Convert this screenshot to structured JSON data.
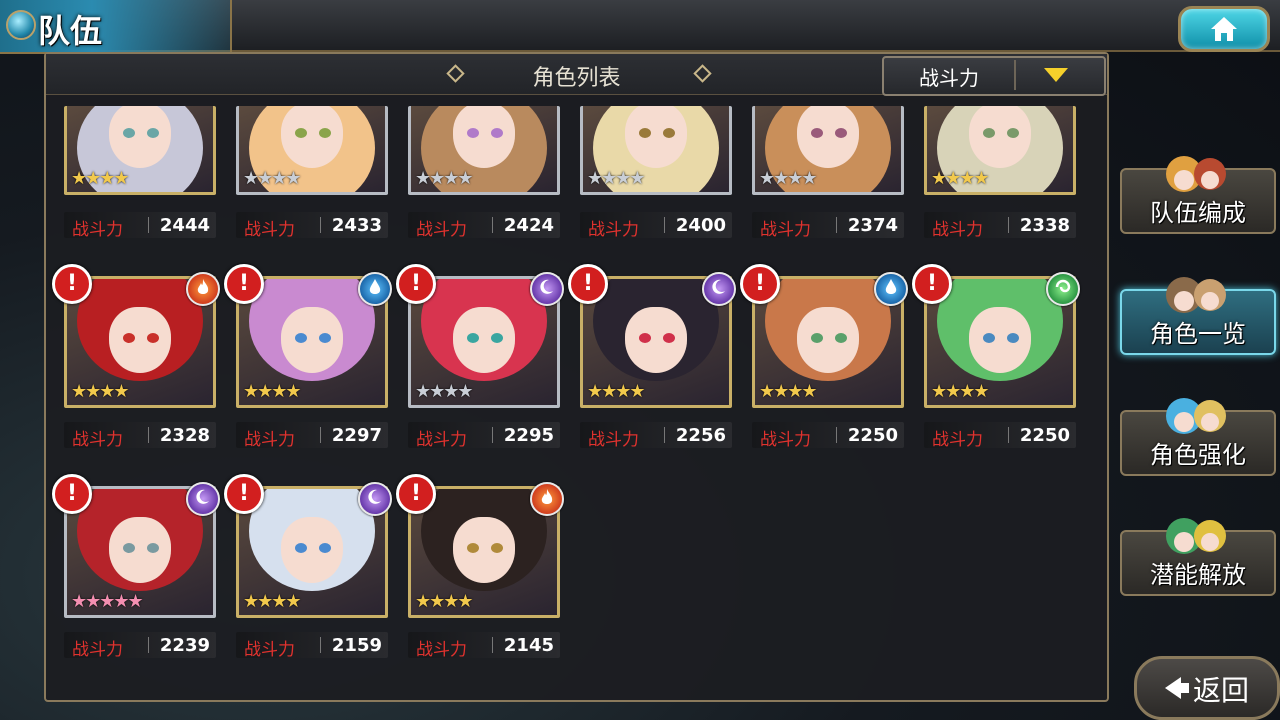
{
  "header": {
    "title": "队伍",
    "home_icon": "home-icon"
  },
  "panel": {
    "title": "角色列表",
    "sort_label": "战斗力"
  },
  "power_label": "战斗力",
  "characters": [
    {
      "power": "2444",
      "stars": 4,
      "star_color": "gold",
      "frame": "gold",
      "alert": false,
      "element": null,
      "hair": "#c7c7d8",
      "eyes": "#6aa6a6"
    },
    {
      "power": "2433",
      "stars": 4,
      "star_color": "silver",
      "frame": "silver",
      "alert": false,
      "element": null,
      "hair": "#f2c38a",
      "eyes": "#8aa44a"
    },
    {
      "power": "2424",
      "stars": 4,
      "star_color": "silver",
      "frame": "silver",
      "alert": false,
      "element": null,
      "hair": "#b98a5e",
      "eyes": "#b07ac9"
    },
    {
      "power": "2400",
      "stars": 4,
      "star_color": "silver",
      "frame": "silver",
      "alert": false,
      "element": null,
      "hair": "#e9d9a8",
      "eyes": "#9a7a3a"
    },
    {
      "power": "2374",
      "stars": 4,
      "star_color": "silver",
      "frame": "silver",
      "alert": false,
      "element": null,
      "hair": "#c98f5a",
      "eyes": "#9a5a7a"
    },
    {
      "power": "2338",
      "stars": 4,
      "star_color": "gold",
      "frame": "gold",
      "alert": false,
      "element": null,
      "hair": "#d8d3b8",
      "eyes": "#7a9a6a"
    },
    {
      "power": "2328",
      "stars": 4,
      "star_color": "gold",
      "frame": "gold",
      "alert": true,
      "element": "fire",
      "hair": "#b81f22",
      "eyes": "#c9302a"
    },
    {
      "power": "2297",
      "stars": 4,
      "star_color": "gold",
      "frame": "gold",
      "alert": true,
      "element": "water",
      "hair": "#c98ad0",
      "eyes": "#4a8ad0"
    },
    {
      "power": "2295",
      "stars": 4,
      "star_color": "silver",
      "frame": "silver",
      "alert": true,
      "element": "dark",
      "hair": "#d8344f",
      "eyes": "#3aa6a0"
    },
    {
      "power": "2256",
      "stars": 4,
      "star_color": "gold",
      "frame": "gold",
      "alert": true,
      "element": "dark",
      "hair": "#2a2430",
      "eyes": "#d0304a"
    },
    {
      "power": "2250",
      "stars": 4,
      "star_color": "gold",
      "frame": "gold",
      "alert": true,
      "element": "water",
      "hair": "#c9784a",
      "eyes": "#5aa06a"
    },
    {
      "power": "2250",
      "stars": 4,
      "star_color": "gold",
      "frame": "gold",
      "alert": true,
      "element": "wind",
      "hair": "#5fbf6a",
      "eyes": "#4a8ac0"
    },
    {
      "power": "2239",
      "stars": 5,
      "star_color": "pink",
      "frame": "silver",
      "alert": true,
      "element": "dark",
      "hair": "#b5232a",
      "eyes": "#7a9aa0"
    },
    {
      "power": "2159",
      "stars": 4,
      "star_color": "gold",
      "frame": "gold",
      "alert": true,
      "element": "dark",
      "hair": "#d6e0ee",
      "eyes": "#4a8ad0"
    },
    {
      "power": "2145",
      "stars": 4,
      "star_color": "gold",
      "frame": "gold",
      "alert": true,
      "element": "fire",
      "hair": "#2c2220",
      "eyes": "#b08a3a"
    }
  ],
  "side_menu": [
    {
      "label": "队伍编成",
      "icon": "team-formation-icon",
      "active": false
    },
    {
      "label": "角色一览",
      "icon": "character-book-icon",
      "active": true
    },
    {
      "label": "角色强化",
      "icon": "enhance-crystal-icon",
      "active": false
    },
    {
      "label": "潜能解放",
      "icon": "potential-orb-icon",
      "active": false
    }
  ],
  "back_label": "返回",
  "element_colors": {
    "fire": "#e0502a",
    "water": "#2a84d0",
    "dark": "#8a4ad0",
    "wind": "#2fae4a"
  }
}
